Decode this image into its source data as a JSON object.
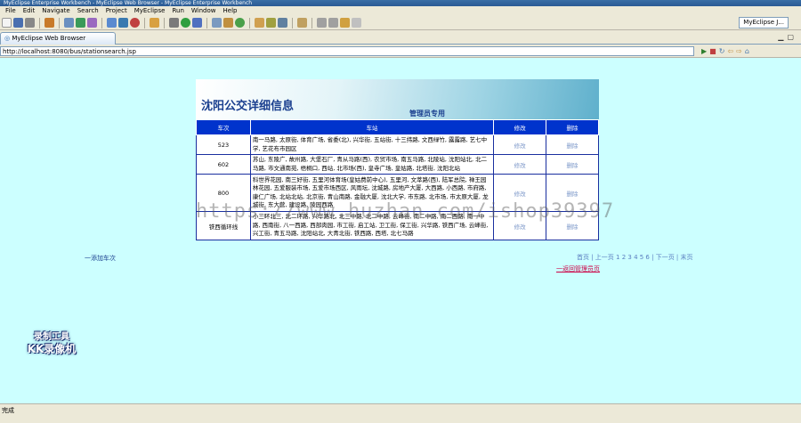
{
  "window": {
    "title": "MyEclipse Enterprise Workbench - MyEclipse Web Browser - MyEclipse Enterprise Workbench"
  },
  "menu": {
    "items": [
      "File",
      "Edit",
      "Navigate",
      "Search",
      "Project",
      "MyEclipse",
      "Run",
      "Window",
      "Help"
    ]
  },
  "toolbar": {
    "perspective_label": "MyEclipse J..."
  },
  "tab": {
    "label": "MyEclipse Web Browser"
  },
  "address": {
    "url": "http://localhost:8080/bus/stationsearch.jsp"
  },
  "page": {
    "title": "沈阳公交详细信息",
    "subtitle": "管理员专用",
    "headers": {
      "route": "车次",
      "stations": "车站",
      "edit": "修改",
      "delete": "删除"
    },
    "rows": [
      {
        "route": "523",
        "stations": "南一马路, 太原街, 体育广场, 省委(北), 兴华街, 五站街, 十三纬路, 文西绿竹, 露露路, 艺七中学, 艺花布市园区",
        "edit": "修改",
        "delete": "删除"
      },
      {
        "route": "602",
        "stations": "苏山, 东陵广, 故州路, 大堡石厂, 青从马路(西), 农贸市场, 南五马路, 北陵站, 沈阳站北, 北二马路, 市文通南苑, 梧桐口, 西站, 北市场(西), 皇寺广场, 皇姑路, 北塔街, 沈阳北站",
        "edit": "修改",
        "delete": "删除"
      },
      {
        "route": "800",
        "stations": "科世界花园, 南三好街, 五里河体育场(皇姑费前中心), 五里河, 文萃路(西), 陆军总院, 禅王园林花园, 五爱服装市场, 五爱市场西区, 风雨坛, 沈城路, 房地产大厦, 大西路, 小西路, 市府路, 康仁广场, 北站北站, 北京街, 青山南路, 金融大厦, 沈北大学, 市东路, 北市场, 市太原大厦, 龙城街, 东大营, 建设路, 陵园西路",
        "edit": "修改",
        "delete": "删除"
      },
      {
        "route": "铁西循环线",
        "stations": "小三环北三, 北二环路, 兴华路北, 北三中路, 北二中路, 云峰街, 南二中路, 南二西路, 南一中路, 西南街, 八一西路, 西部肉园, 市工街, 启工站, 卫工街, 保工街, 兴华路, 铁西广场, 云峰街, 兴工街, 青五马路, 沈阳站北, 大青北街, 铁西路, 西塔, 北七马路",
        "edit": "修改",
        "delete": "删除"
      }
    ],
    "add_link": "一添加车次",
    "pager": "首页 | 上一页 1 2 3 4 5 6 | 下一页 | 末页",
    "back_link": "一返回管理员页"
  },
  "overlay": {
    "watermark": "https://www.huzhan.com/ishop39397",
    "recorder_line1": "录制工具",
    "recorder_line2": "KK录像机"
  },
  "status": {
    "text": "完成"
  }
}
